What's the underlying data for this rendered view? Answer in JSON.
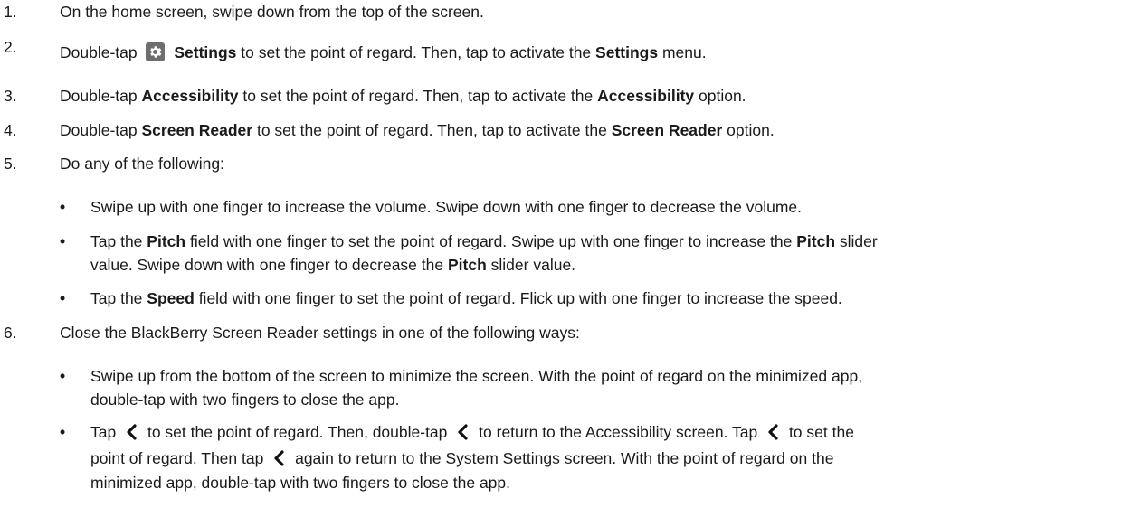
{
  "steps": [
    {
      "num": "1.",
      "text": "On the home screen, swipe down from the top of the screen."
    },
    {
      "num": "2.",
      "p1": "Double-tap",
      "b1": "Settings",
      "p2": "to set the point of regard. Then, tap to activate the",
      "b2": "Settings",
      "p3": "menu."
    },
    {
      "num": "3.",
      "p1": "Double-tap",
      "b1": "Accessibility",
      "p2": "to set the point of regard. Then, tap to activate the",
      "b2": "Accessibility",
      "p3": "option."
    },
    {
      "num": "4.",
      "p1": "Double-tap",
      "b1": "Screen Reader",
      "p2": "to set the point of regard. Then, tap to activate the",
      "b2": "Screen Reader",
      "p3": "option."
    },
    {
      "num": "5.",
      "text": "Do any of the following:",
      "bullets": [
        {
          "text": "Swipe up with one finger to increase the volume. Swipe down with one finger to decrease the volume."
        },
        {
          "p1": "Tap the",
          "b1": "Pitch",
          "p2": "field with one finger to set the point of regard. Swipe up with one finger to increase the",
          "b2": "Pitch",
          "p3": "slider",
          "line2a": "value. Swipe down with one finger to decrease the",
          "line2b": "Pitch",
          "line2c": "slider value."
        },
        {
          "p1": "Tap the",
          "b1": "Speed",
          "p2": "field with one finger to set the point of regard. Flick up with one finger to increase the speed."
        }
      ]
    },
    {
      "num": "6.",
      "text": "Close the BlackBerry Screen Reader settings in one of the following ways:",
      "bullets": [
        {
          "line1": "Swipe up from the bottom of the screen to minimize the screen. With the point of regard on the minimized app,",
          "line2": "double-tap with two fingers to close the app."
        },
        {
          "a": "Tap",
          "b": "to set the point of regard. Then, double-tap",
          "c": "to return to the Accessibility screen. Tap",
          "d": "to set the",
          "line2a": "point of regard. Then tap",
          "line2b": "again to return to the System Settings screen. With the point of regard on the",
          "line3": "minimized app, double-tap with two fingers to close the app."
        }
      ]
    }
  ],
  "bullet_glyph": "•",
  "icons": {
    "settings": "settings-gear-icon",
    "back": "back-chevron-icon"
  }
}
